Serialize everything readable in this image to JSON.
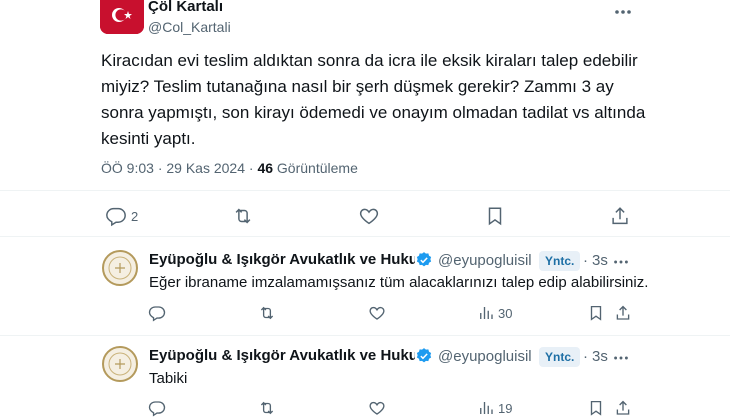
{
  "main_tweet": {
    "author_name": "Çöl Kartalı",
    "author_handle": "@Col_Kartali",
    "text": "Kiracıdan evi teslim aldıktan sonra da icra ile eksik kiraları talep edebilir miyiz? Teslim tutanağına nasıl bir şerh düşmek gerekir? Zammı 3 ay sonra yapmıştı, son kirayı ödemedi ve onayım olmadan tadilat vs altında kesinti yaptı.",
    "time": "ÖÖ 9:03",
    "separator": "·",
    "date": "29 Kas 2024",
    "views_count": "46",
    "views_label": "Görüntüleme",
    "reply_count": "2",
    "avatar_colors": {
      "flag_red": "#c8102e",
      "flag_white": "#ffffff"
    }
  },
  "replies": [
    {
      "author_name": "Eyüpoğlu & Işıkgör Avukatlık ve Hukuk B",
      "author_handle": "@eyupogluisil",
      "badge": "Yntc.",
      "time": "3s",
      "separator": "·",
      "text": "Eğer ibraname imzalamamışsanız tüm alacaklarınızı talep edip alabilirsiniz.",
      "views_count": "30"
    },
    {
      "author_name": "Eyüpoğlu & Işıkgör Avukatlık ve Hukuk B",
      "author_handle": "@eyupogluisil",
      "badge": "Yntc.",
      "time": "3s",
      "separator": "·",
      "text": "Tabiki",
      "views_count": "19"
    }
  ],
  "colors": {
    "verified": "#1d9bf0",
    "muted": "#536471",
    "text": "#0f1419",
    "badge_bg": "#e8f0f7",
    "badge_text": "#1d6fa5"
  }
}
